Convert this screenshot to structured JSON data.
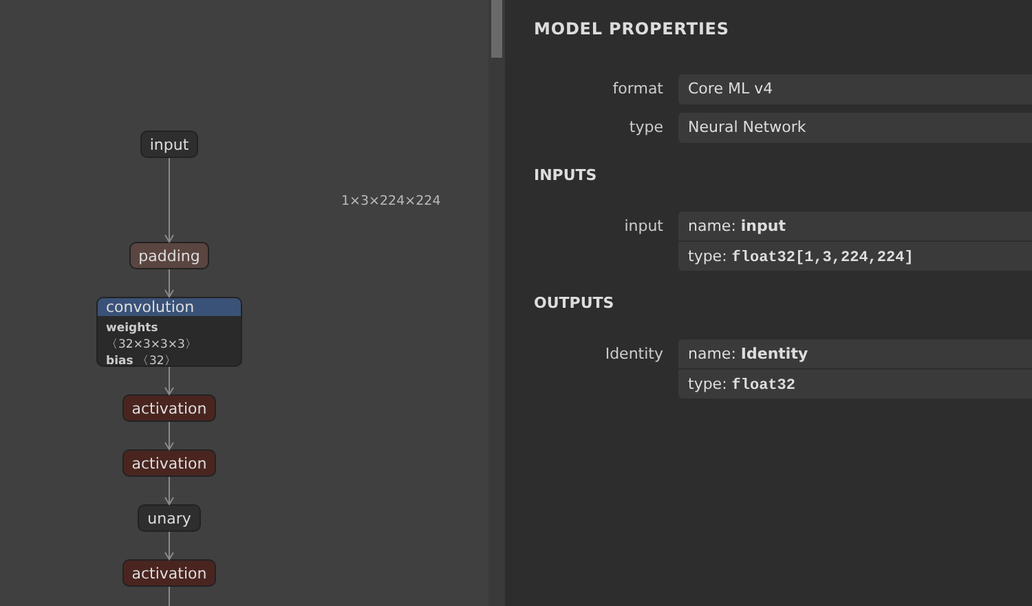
{
  "graph": {
    "nodes": [
      {
        "label": "input",
        "kind": "io",
        "edge_label": "1×3×224×224"
      },
      {
        "label": "padding",
        "kind": "layer"
      },
      {
        "label": "convolution",
        "kind": "conv",
        "attributes": [
          {
            "name": "weights",
            "value": "〈32×3×3×3〉"
          },
          {
            "name": "bias",
            "value": "〈32〉"
          }
        ]
      },
      {
        "label": "activation",
        "kind": "activation"
      },
      {
        "label": "activation",
        "kind": "activation"
      },
      {
        "label": "unary",
        "kind": "transform"
      },
      {
        "label": "activation",
        "kind": "activation"
      }
    ]
  },
  "sidebar": {
    "title": "MODEL PROPERTIES",
    "properties": [
      {
        "label": "format",
        "value": "Core ML v4"
      },
      {
        "label": "type",
        "value": "Neural Network"
      }
    ],
    "sections": [
      {
        "title": "INPUTS",
        "items": [
          {
            "label": "input",
            "lines": [
              {
                "kind": "name",
                "key": "name:",
                "value": "input"
              },
              {
                "kind": "type",
                "key": "type:",
                "value": "float32[1,3,224,224]"
              }
            ]
          }
        ]
      },
      {
        "title": "OUTPUTS",
        "items": [
          {
            "label": "Identity",
            "lines": [
              {
                "kind": "name",
                "key": "name:",
                "value": "Identity"
              },
              {
                "kind": "type",
                "key": "type:",
                "value": "float32"
              }
            ]
          }
        ]
      }
    ]
  }
}
